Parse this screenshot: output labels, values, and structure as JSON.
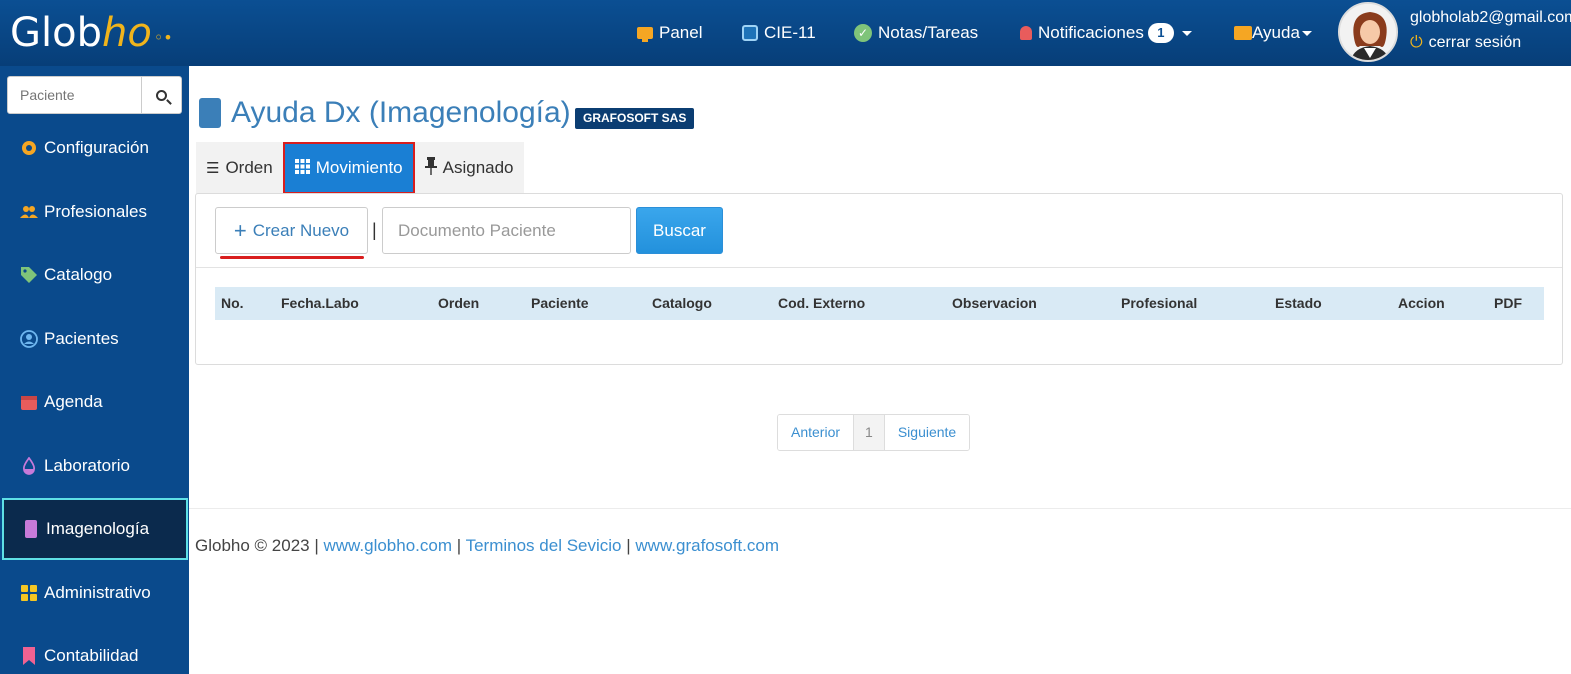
{
  "brand": {
    "logo_text_a": "Glob",
    "logo_text_b": "ho"
  },
  "topnav": {
    "panel": "Panel",
    "cie": "CIE-11",
    "notes": "Notas/Tareas",
    "notifications": "Notificaciones",
    "notifications_count": "1",
    "help": "Ayuda"
  },
  "user": {
    "email": "globholab2@gmail.com",
    "logout": "cerrar sesión"
  },
  "sidebar": {
    "search_placeholder": "Paciente",
    "items": [
      {
        "label": "Configuración"
      },
      {
        "label": "Profesionales"
      },
      {
        "label": "Catalogo"
      },
      {
        "label": "Pacientes"
      },
      {
        "label": "Agenda"
      },
      {
        "label": "Laboratorio"
      },
      {
        "label": "Imagenología"
      },
      {
        "label": "Administrativo"
      },
      {
        "label": "Contabilidad"
      }
    ]
  },
  "page": {
    "title": "Ayuda Dx (Imagenología)",
    "company": "GRAFOSOFT SAS"
  },
  "tabs": [
    {
      "label": "Orden"
    },
    {
      "label": "Movimiento"
    },
    {
      "label": "Asignado"
    }
  ],
  "toolbar": {
    "create_label": "Crear Nuevo",
    "separator": "|",
    "doc_placeholder": "Documento Paciente",
    "search_label": "Buscar"
  },
  "table": {
    "columns": [
      "No.",
      "Fecha.Labo",
      "Orden",
      "Paciente",
      "Catalogo",
      "Cod. Externo",
      "Observacion",
      "Profesional",
      "Estado",
      "Accion",
      "PDF"
    ]
  },
  "pagination": {
    "prev": "Anterior",
    "current": "1",
    "next": "Siguiente"
  },
  "footer": {
    "copyright": "Globho © 2023",
    "sep": "|",
    "link1": "www.globho.com",
    "link2": "Terminos del Sevicio",
    "link3": "www.grafosoft.com"
  },
  "colors": {
    "topbar": "#0b4f93",
    "sidebar": "#0a4a8c",
    "accent": "#1a7fd4",
    "highlight": "#d91e1e"
  }
}
